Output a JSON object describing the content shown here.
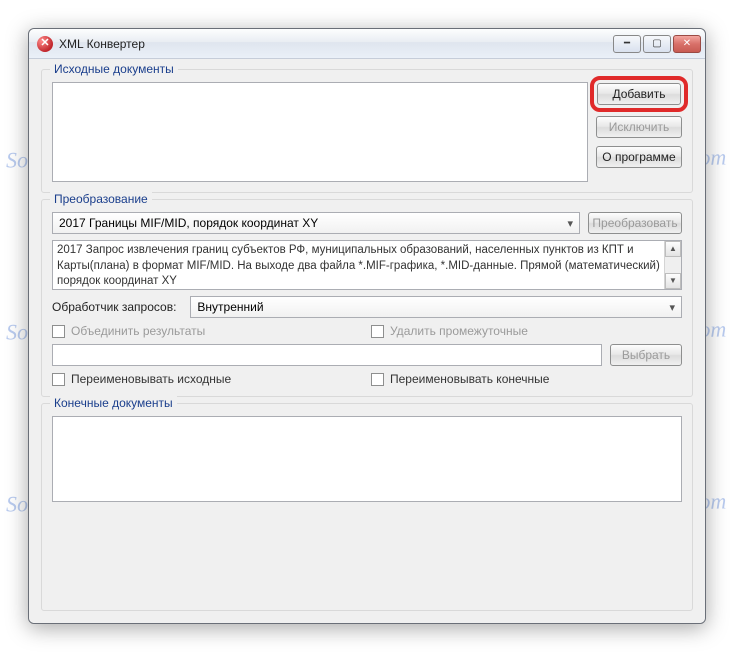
{
  "watermark_text": "Soringpcrepair.Com",
  "window": {
    "title": "XML Конвертер"
  },
  "source": {
    "group_label": "Исходные документы",
    "add_button": "Добавить",
    "remove_button": "Исключить",
    "about_button": "О программе"
  },
  "transform": {
    "group_label": "Преобразование",
    "selected_option": "2017 Границы MIF/MID, порядок координат XY",
    "convert_button": "Преобразовать",
    "description_line1": "2017 Запрос извлечения границ субъектов РФ, муниципальных образований, населенных пунктов из КПТ и",
    "description_line2": "Карты(плана) в формат MIF/MID. На выходе два файла *.MIF-графика, *.MID-данные. Прямой (математический)",
    "description_line3": "порядок координат XY",
    "handler_label": "Обработчик запросов:",
    "handler_value": "Внутренний",
    "merge_label": "Объединить результаты",
    "delete_temp_label": "Удалить промежуточные",
    "select_button": "Выбрать",
    "rename_source_label": "Переименовывать исходные",
    "rename_final_label": "Переименовывать конечные"
  },
  "final": {
    "group_label": "Конечные документы"
  }
}
